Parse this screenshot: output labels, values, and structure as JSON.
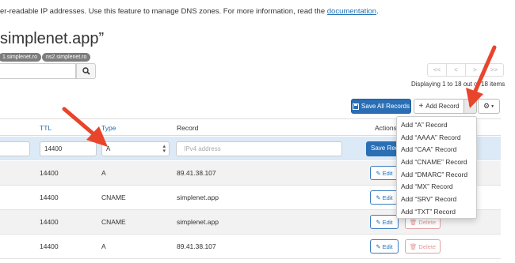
{
  "intro": {
    "text": "er-readable IP addresses. Use this feature to manage DNS zones. For more information, read the ",
    "link": "documentation",
    "suffix": "."
  },
  "domain_title": "simplenet.app”",
  "nameservers": [
    "1.simplenet.ro",
    "ns2.simplenet.ro"
  ],
  "pagination": {
    "buttons": [
      "<<",
      "<",
      ">",
      ">>"
    ],
    "display_text": "Displaying 1 to 18 out of 18 items"
  },
  "toolbar": {
    "save_all_label": "Save All Records",
    "add_record_label": "Add Record",
    "add_menu_items": [
      "Add “A” Record",
      "Add “AAAA” Record",
      "Add “CAA” Record",
      "Add “CNAME” Record",
      "Add “DMARC” Record",
      "Add “MX” Record",
      "Add “SRV” Record",
      "Add “TXT” Record"
    ]
  },
  "table": {
    "headers": {
      "ttl": "TTL",
      "type": "Type",
      "record": "Record",
      "actions": "Actions"
    },
    "edit_row": {
      "ttl": "14400",
      "type": "A",
      "record_placeholder": "IPv4 address",
      "save_label": "Save Record"
    },
    "rows": [
      {
        "ttl": "14400",
        "type": "A",
        "record": "89.41.38.107"
      },
      {
        "ttl": "14400",
        "type": "CNAME",
        "record": "simplenet.app"
      },
      {
        "ttl": "14400",
        "type": "CNAME",
        "record": "simplenet.app"
      },
      {
        "ttl": "14400",
        "type": "A",
        "record": "89.41.38.107"
      }
    ],
    "edit_label": "Edit",
    "delete_label": "Delete"
  },
  "colors": {
    "primary": "#2a6fb5",
    "link": "#1f6fb2",
    "edit_row_bg": "#dce9f6",
    "annotation_arrow": "#e8452c",
    "delete": "#e59a9a"
  }
}
